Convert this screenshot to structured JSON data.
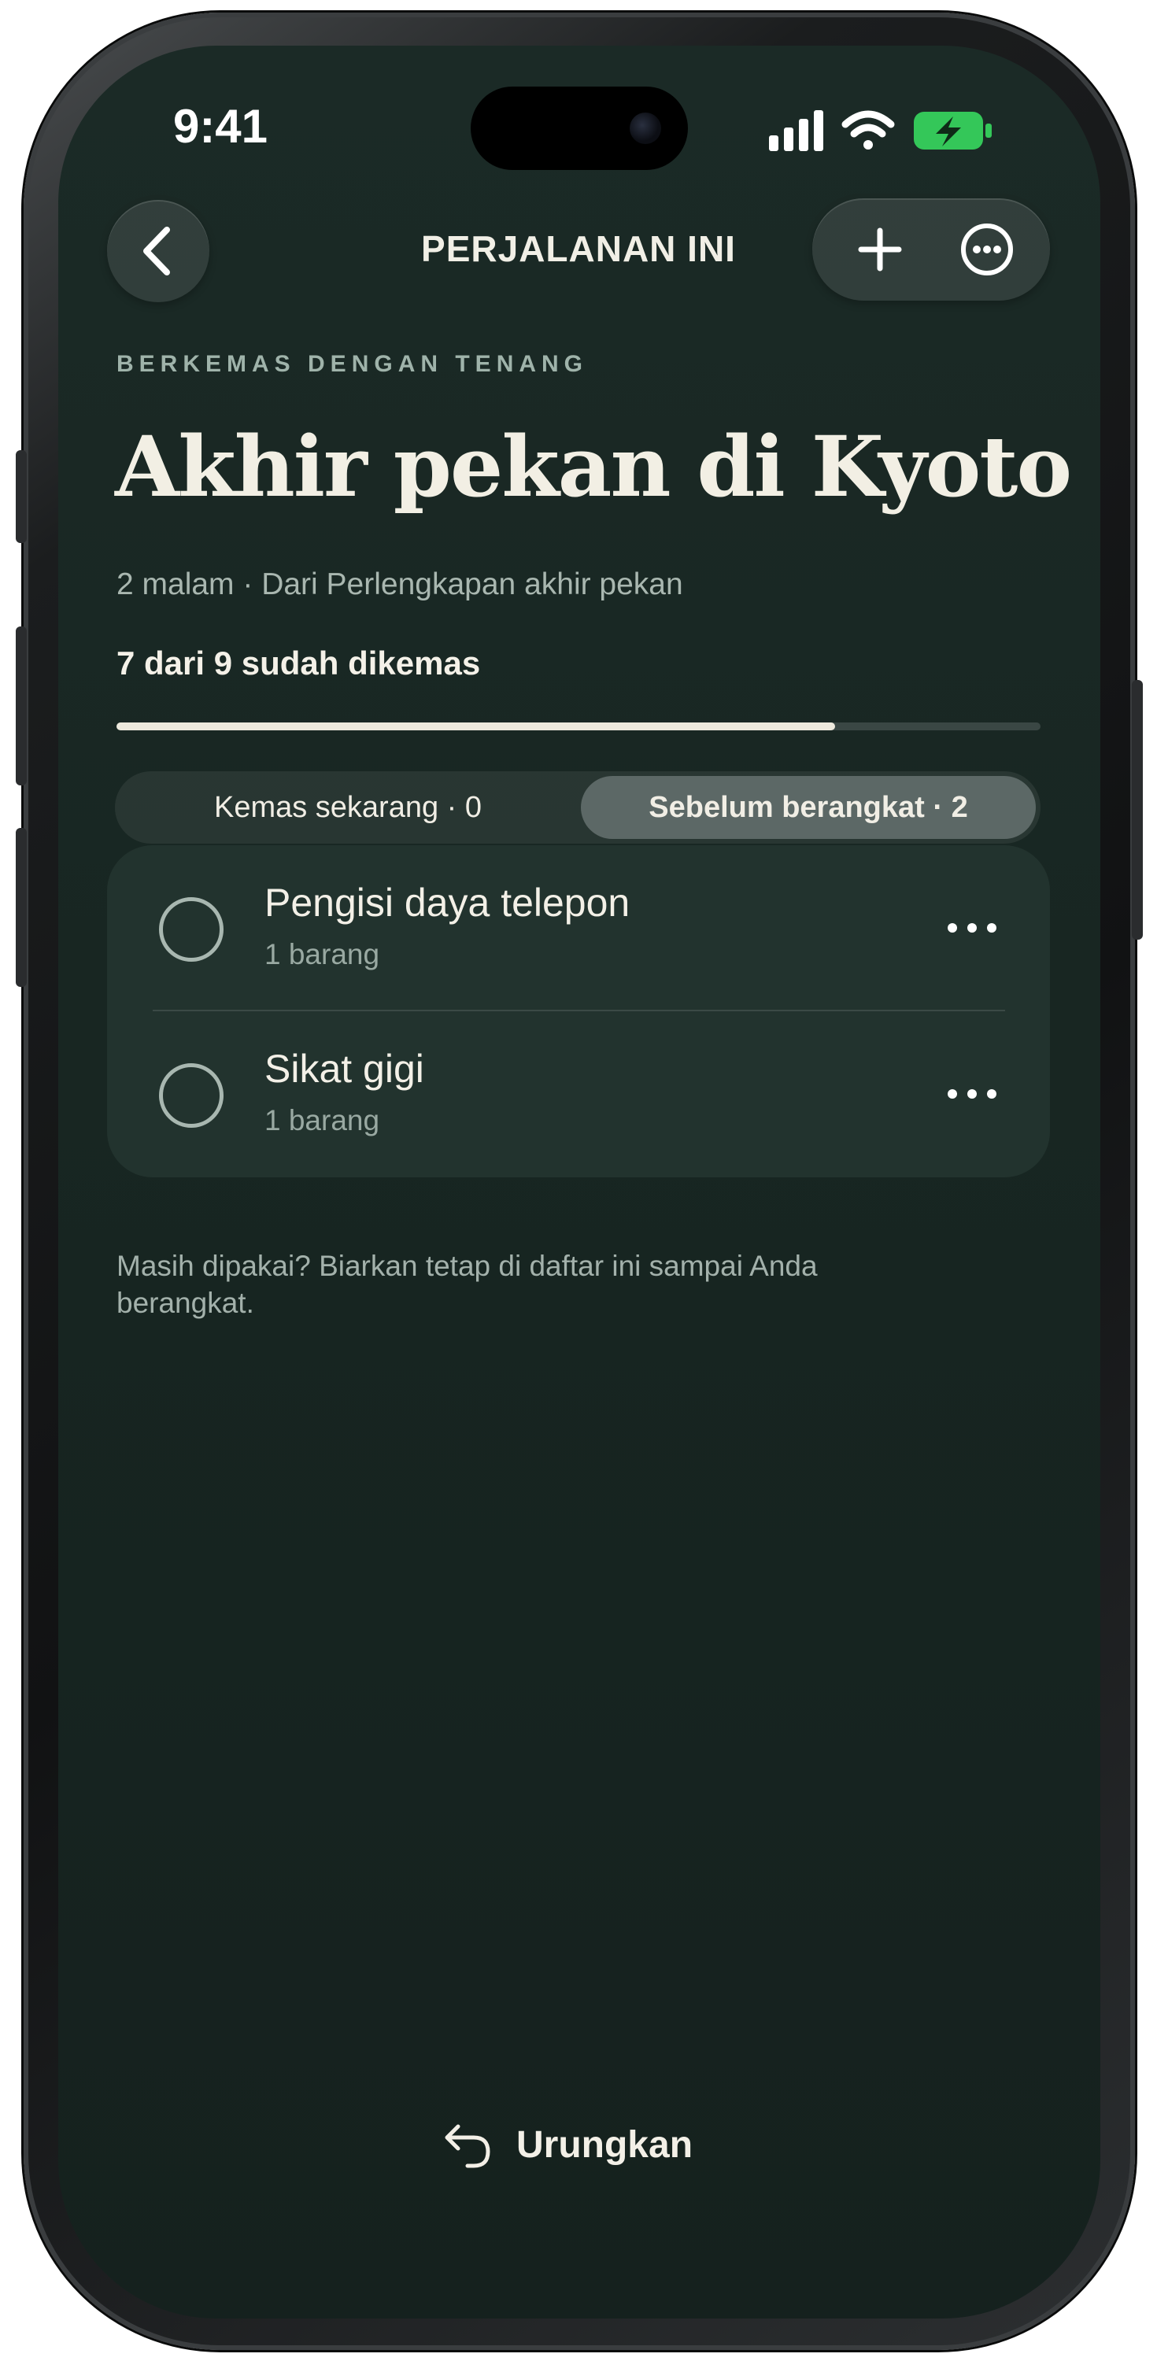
{
  "status_bar": {
    "time": "9:41",
    "icons": [
      "cellular-signal-icon",
      "wifi-icon",
      "battery-charging-icon"
    ]
  },
  "nav": {
    "back_icon": "chevron-left-icon",
    "title": "PERJALANAN INI",
    "add_icon": "plus-icon",
    "more_icon": "ellipsis-circle-icon"
  },
  "header": {
    "eyebrow": "BERKEMAS DENGAN TENANG",
    "title": "Akhir pekan di Kyoto",
    "subtitle": "2 malam · Dari Perlengkapan akhir pekan",
    "progress_label": "7 dari 9 sudah dikemas",
    "progress": {
      "packed": 7,
      "total": 9
    }
  },
  "segments": [
    {
      "label": "Kemas sekarang · 0",
      "active": false
    },
    {
      "label": "Sebelum berangkat · 2",
      "active": true
    }
  ],
  "items": [
    {
      "name": "Pengisi daya telepon",
      "meta": "1 barang"
    },
    {
      "name": "Sikat gigi",
      "meta": "1 barang"
    }
  ],
  "note": "Masih dipakai? Biarkan tetap di daftar ini sampai Anda berangkat.",
  "undo": {
    "icon": "undo-arrow-icon",
    "label": "Urungkan"
  },
  "colors": {
    "background": "#172521",
    "card": "#22332e",
    "text_primary": "#f2efe4",
    "text_secondary": "#a9b7b0",
    "battery_green": "#34c759"
  }
}
